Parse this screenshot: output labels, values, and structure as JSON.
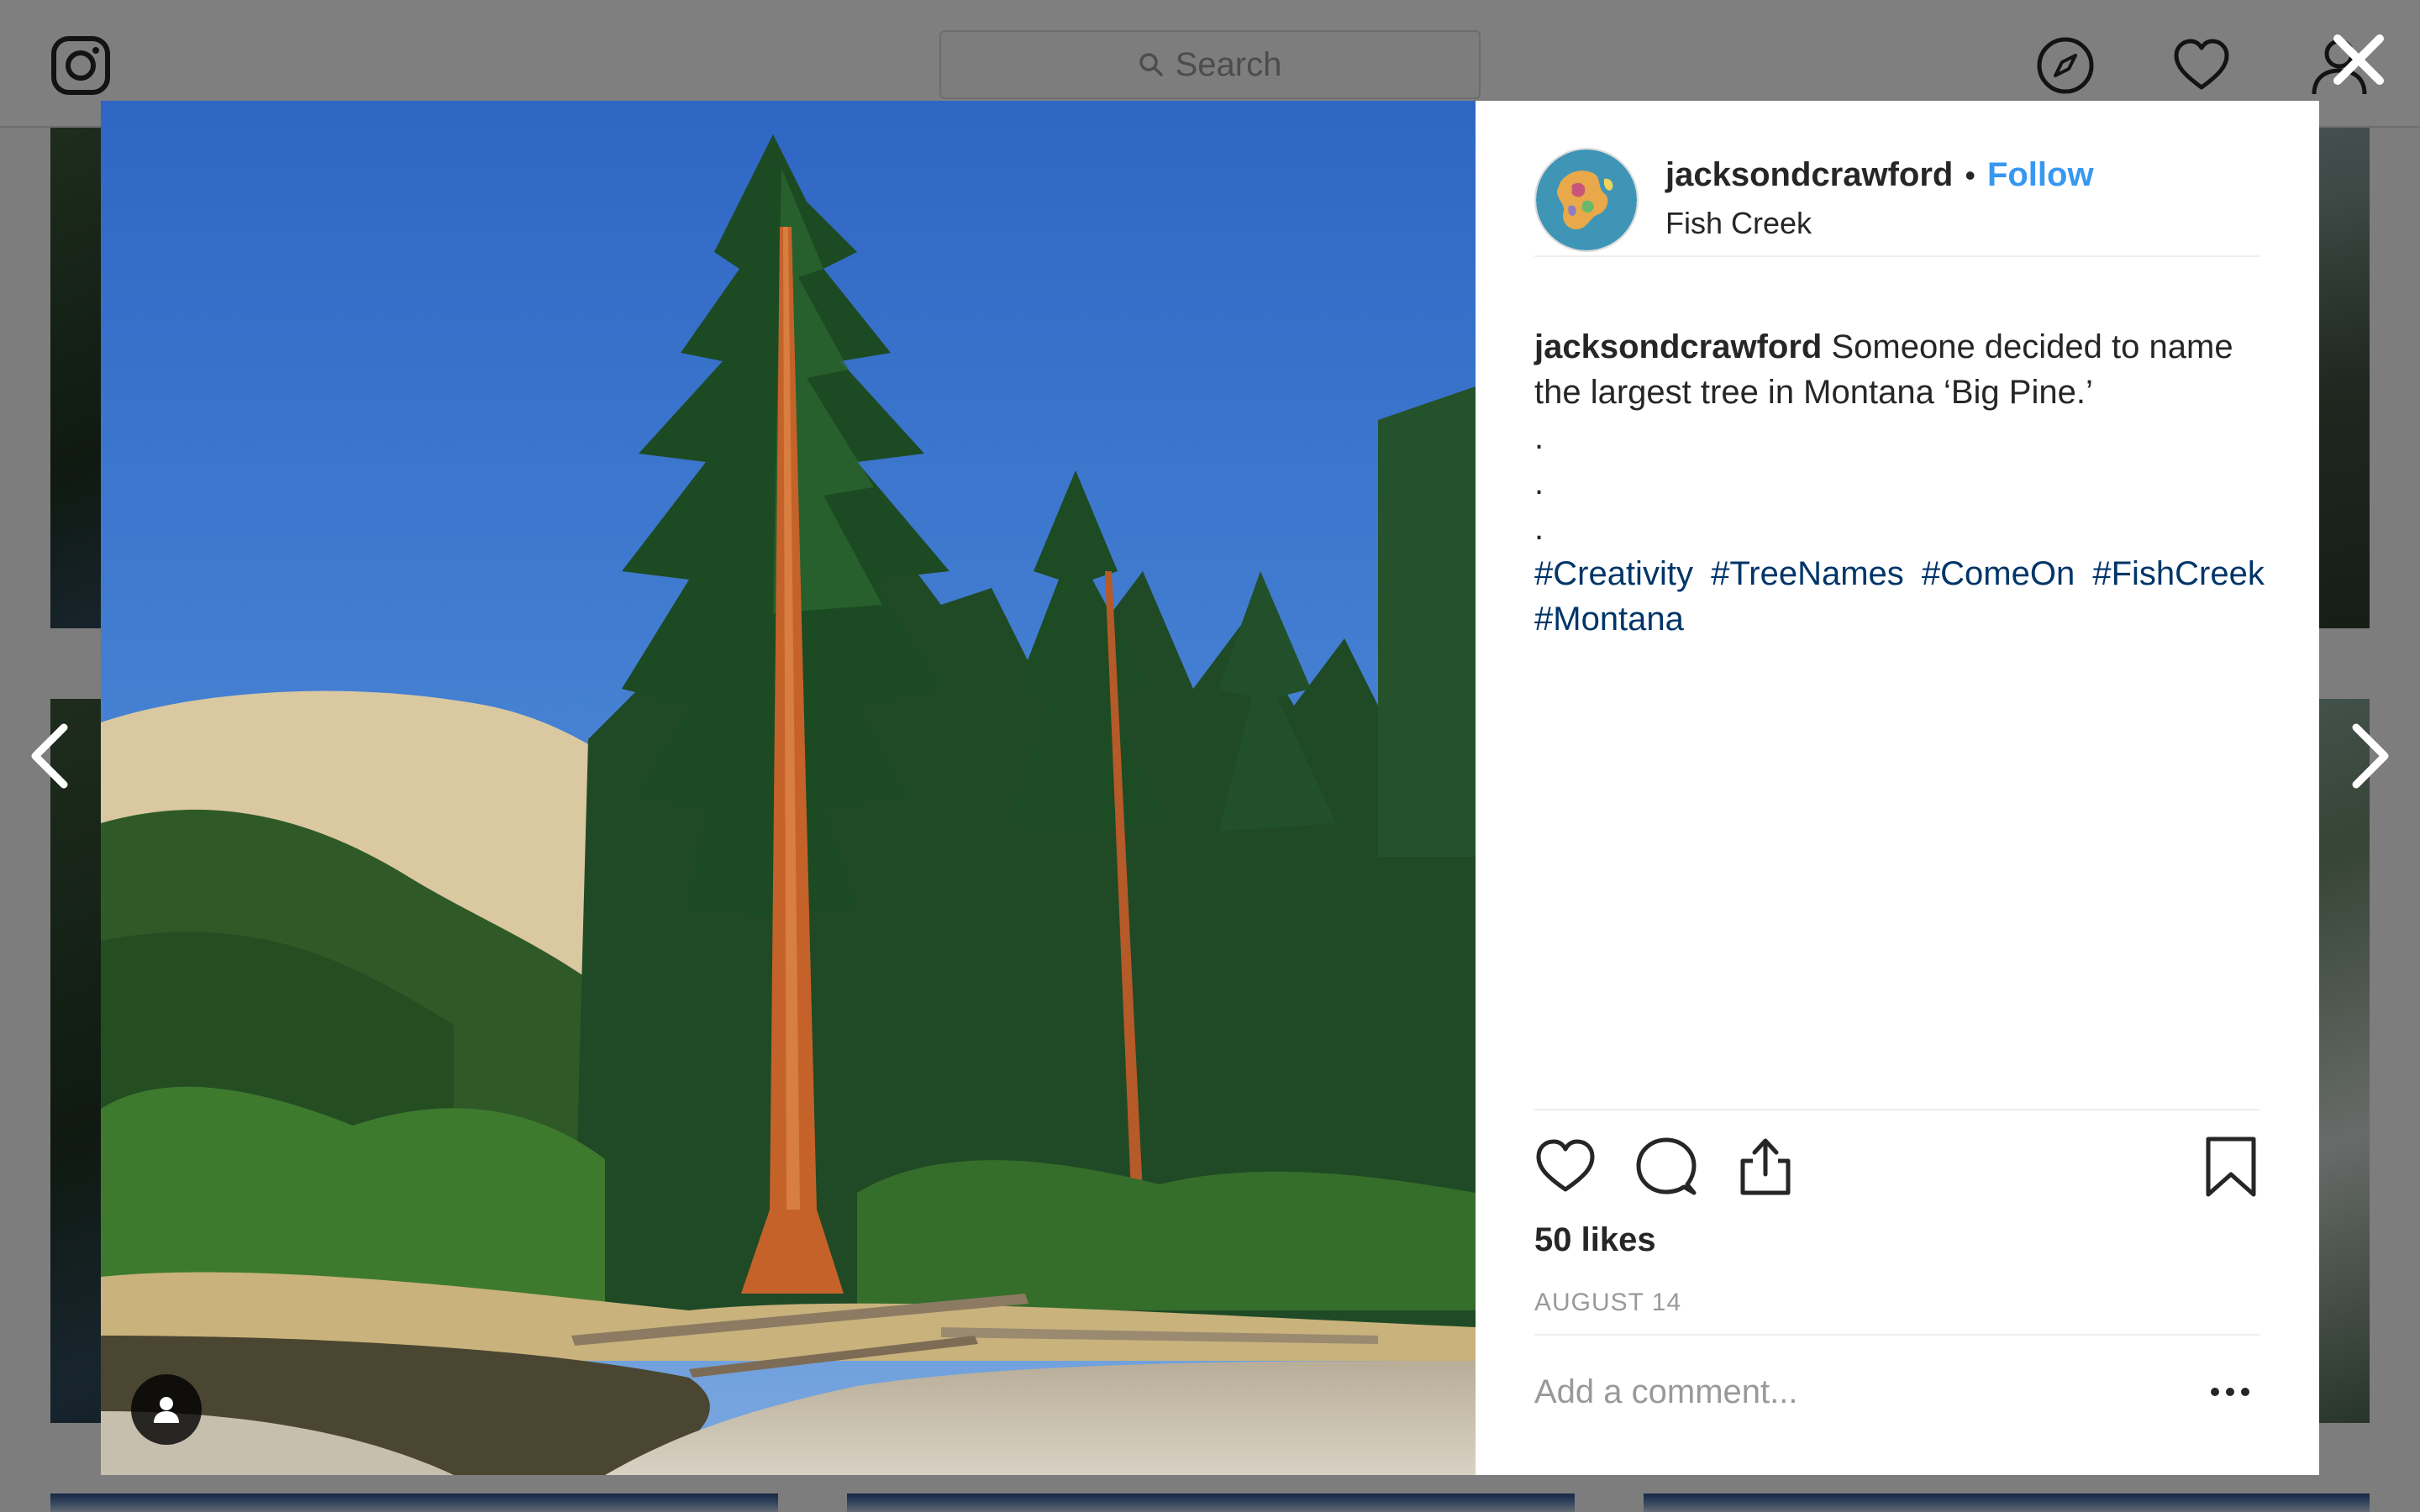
{
  "topbar": {
    "search_placeholder": "Search",
    "icons": [
      "instagram-logo",
      "search-icon",
      "explore-compass-icon",
      "activity-heart-icon",
      "profile-icon"
    ]
  },
  "modal": {
    "close_icon": "close-icon",
    "prev_icon": "chevron-left-icon",
    "next_icon": "chevron-right-icon"
  },
  "post": {
    "username": "jacksondcrawford",
    "separator": "•",
    "follow_label": "Follow",
    "location": "Fish Creek",
    "caption_user": "jacksondcrawford",
    "caption_text": "Someone decided to name the largest tree in Montana ‘Big Pine.’",
    "caption_dots": [
      ".",
      ".",
      "."
    ],
    "hashtags": [
      "#Creativity",
      "#TreeNames",
      "#ComeOn",
      "#FishCreek",
      "#Montana"
    ],
    "likes": "50 likes",
    "date": "AUGUST 14",
    "comment_placeholder": "Add a comment...",
    "action_icons": [
      "like-heart-icon",
      "comment-bubble-icon",
      "share-icon",
      "bookmark-icon",
      "more-options-icon",
      "user-tag-icon"
    ]
  },
  "colors": {
    "follow_blue": "#3897f0",
    "hashtag_blue": "#003569",
    "text_dark": "#262626",
    "muted": "#999999",
    "divider": "#efefef"
  }
}
